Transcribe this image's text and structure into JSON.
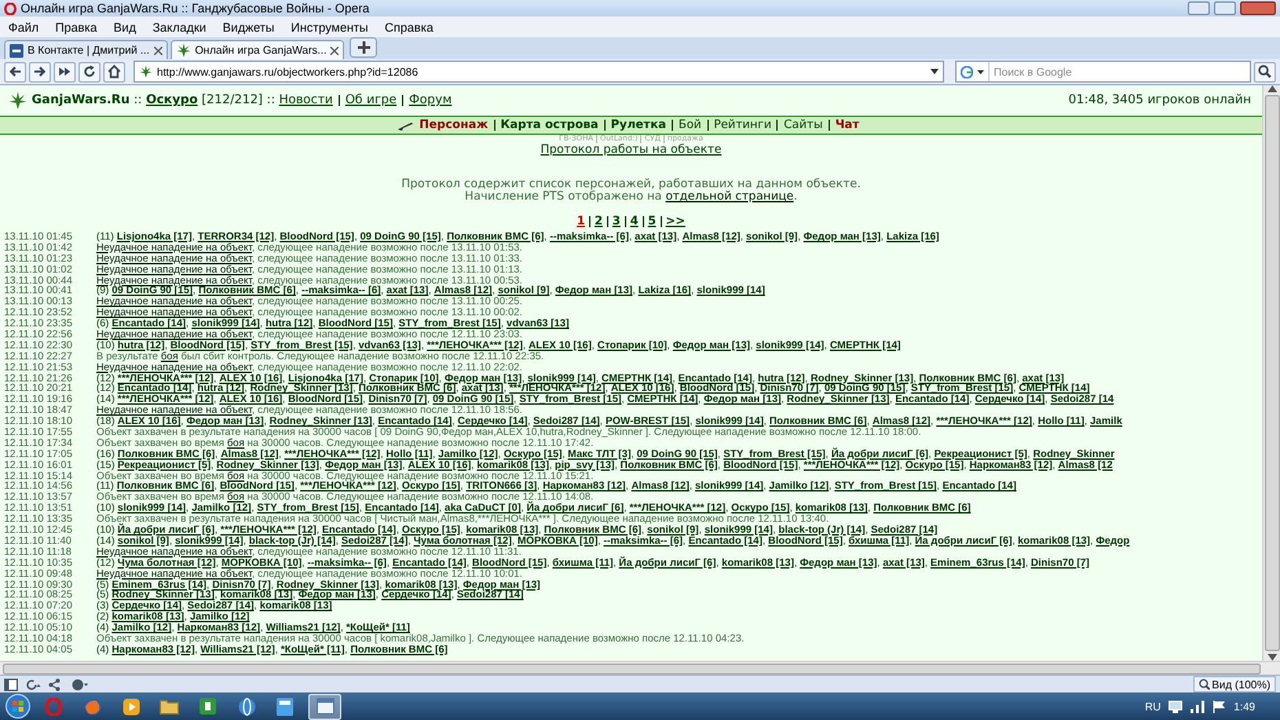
{
  "window": {
    "title": "Онлайн игра GanjaWars.Ru :: Ганджубасовые Войны - Opera"
  },
  "menu": [
    "Файл",
    "Правка",
    "Вид",
    "Закладки",
    "Виджеты",
    "Инструменты",
    "Справка"
  ],
  "tabs": [
    {
      "label": "В Контакте | Дмитрий ...",
      "selected": false,
      "kind": "vk"
    },
    {
      "label": "Онлайн игра GanjaWars...",
      "selected": true,
      "kind": "leaf"
    }
  ],
  "address": "http://www.ganjawars.ru/objectworkers.php?id=12086",
  "search": {
    "placeholder": "Поиск в Google"
  },
  "header": {
    "segments": [
      {
        "text": "GanjaWars.Ru",
        "kind": "brand"
      },
      {
        "text": " :: ",
        "kind": "text"
      },
      {
        "text": "Оскуро",
        "kind": "link"
      },
      {
        "text": " [212/212] :: ",
        "kind": "text"
      },
      {
        "text": "Новости",
        "kind": "menu"
      },
      {
        "text": "Об игре",
        "kind": "menu"
      },
      {
        "text": "Форум",
        "kind": "menu"
      }
    ],
    "online": "01:48, 3405 игроков онлайн"
  },
  "nav": [
    {
      "label": "Персонаж",
      "kind": "hot"
    },
    {
      "label": "Карта острова",
      "kind": "bold"
    },
    {
      "label": "Рулетка",
      "kind": "bold"
    },
    {
      "label": "Бой",
      "kind": "normal"
    },
    {
      "label": "Рейтинги",
      "kind": "normal"
    },
    {
      "label": "Сайты",
      "kind": "normal"
    },
    {
      "label": "Чат",
      "kind": "hot"
    }
  ],
  "sublinks": [
    "ГВ-ЗОНА",
    "OutLand:)",
    "СУД",
    "продажа"
  ],
  "protocol_link": "Протокол работы на объекте",
  "intro": [
    [
      {
        "text": "Протокол содержит список персонажей, работавших на данном объекте.",
        "link": false
      }
    ],
    [
      {
        "text": "Начисление PTS отображено на ",
        "link": false
      },
      {
        "text": "отдельной странице",
        "link": true
      },
      {
        "text": ".",
        "link": false
      }
    ]
  ],
  "pages": [
    {
      "label": "1",
      "selected": true
    },
    {
      "label": "2",
      "selected": false
    },
    {
      "label": "3",
      "selected": false
    },
    {
      "label": "4",
      "selected": false
    },
    {
      "label": "5",
      "selected": false
    },
    {
      "label": ">>",
      "selected": false
    }
  ],
  "separator": ", ",
  "log": [
    {
      "time": "13.11.10 01:45",
      "kind": "party",
      "count": "(11) ",
      "players": [
        "Lisjono4ka [17]",
        "TERROR34 [12]",
        "BloodNord [15]",
        "09 DoinG 90 [15]",
        "Полковник ВМС [6]",
        "--maksimka-- [6]",
        "axat [13]",
        "Almas8 [12]",
        "sonikol [9]",
        "Федор ман [13]",
        "Lakiza [16]"
      ]
    },
    {
      "time": "13.11.10 01:42",
      "kind": "event",
      "segments": [
        {
          "text": "Неудачное нападение на объект",
          "link": true
        },
        {
          "text": ", следующее нападение возможно после 13.11.10 01:53.",
          "link": false
        }
      ]
    },
    {
      "time": "13.11.10 01:23",
      "kind": "event",
      "segments": [
        {
          "text": "Неудачное нападение на объект",
          "link": true
        },
        {
          "text": ", следующее нападение возможно после 13.11.10 01:33.",
          "link": false
        }
      ]
    },
    {
      "time": "13.11.10 01:02",
      "kind": "event",
      "segments": [
        {
          "text": "Неудачное нападение на объект",
          "link": true
        },
        {
          "text": ", следующее нападение возможно после 13.11.10 01:13.",
          "link": false
        }
      ]
    },
    {
      "time": "13.11.10 00:44",
      "kind": "event",
      "segments": [
        {
          "text": "Неудачное нападение на объект",
          "link": true
        },
        {
          "text": ", следующее нападение возможно после 13.11.10 00:53.",
          "link": false
        }
      ]
    },
    {
      "time": "13.11.10 00:41",
      "kind": "party",
      "count": "(9) ",
      "players": [
        "09 DoinG 90 [15]",
        "Полковник ВМС [6]",
        "--maksimka-- [6]",
        "axat [13]",
        "Almas8 [12]",
        "sonikol [9]",
        "Федор ман [13]",
        "Lakiza [16]",
        "slonik999 [14]"
      ]
    },
    {
      "time": "13.11.10 00:13",
      "kind": "event",
      "segments": [
        {
          "text": "Неудачное нападение на объект",
          "link": true
        },
        {
          "text": ", следующее нападение возможно после 13.11.10 00:25.",
          "link": false
        }
      ]
    },
    {
      "time": "12.11.10 23:52",
      "kind": "event",
      "segments": [
        {
          "text": "Неудачное нападение на объект",
          "link": true
        },
        {
          "text": ", следующее нападение возможно после 13.11.10 00:02.",
          "link": false
        }
      ]
    },
    {
      "time": "12.11.10 23:35",
      "kind": "party",
      "count": "(6) ",
      "players": [
        "Encantado [14]",
        "slonik999 [14]",
        "hutra [12]",
        "BloodNord [15]",
        "STY_from_Brest [15]",
        "vdvan63 [13]"
      ]
    },
    {
      "time": "12.11.10 22:56",
      "kind": "event",
      "segments": [
        {
          "text": "Неудачное нападение на объект",
          "link": true
        },
        {
          "text": ", следующее нападение возможно после 12.11.10 23:03.",
          "link": false
        }
      ]
    },
    {
      "time": "12.11.10 22:30",
      "kind": "party",
      "count": "(10) ",
      "players": [
        "hutra [12]",
        "BloodNord [15]",
        "STY_from_Brest [15]",
        "vdvan63 [13]",
        "***ЛЕНОЧКА*** [12]",
        "ALEX 10 [16]",
        "Стопарик [10]",
        "Федор ман [13]",
        "slonik999 [14]",
        "СМЕРТНК [14]"
      ]
    },
    {
      "time": "12.11.10 22:27",
      "kind": "event",
      "segments": [
        {
          "text": "В результате ",
          "link": false
        },
        {
          "text": "боя",
          "link": true
        },
        {
          "text": " был сбит контроль. Следующее нападение возможно после 12.11.10 22:35.",
          "link": false
        }
      ]
    },
    {
      "time": "12.11.10 21:53",
      "kind": "event",
      "segments": [
        {
          "text": "Неудачное нападение на объект",
          "link": true
        },
        {
          "text": ", следующее нападение возможно после 12.11.10 22:02.",
          "link": false
        }
      ]
    },
    {
      "time": "12.11.10 21:26",
      "kind": "party",
      "count": "(12) ",
      "players": [
        "***ЛЕНОЧКА*** [12]",
        "ALEX 10 [16]",
        "Lisjono4ka [17]",
        "Стопарик [10]",
        "Федор ман [13]",
        "slonik999 [14]",
        "СМЕРТНК [14]",
        "Encantado [14]",
        "hutra [12]",
        "Rodney_Skinner [13]",
        "Полковник ВМС [6]",
        "axat [13]"
      ]
    },
    {
      "time": "12.11.10 20:21",
      "kind": "party",
      "count": "(12) ",
      "players": [
        "Encantado [14]",
        "hutra [12]",
        "Rodney_Skinner [13]",
        "Полковник ВМС [6]",
        "axat [13]",
        "***ЛЕНОЧКА*** [12]",
        "ALEX 10 [16]",
        "BloodNord [15]",
        "Dinisn70 [7]",
        "09 DoinG 90 [15]",
        "STY_from_Brest [15]",
        "СМЕРТНК [14]"
      ]
    },
    {
      "time": "12.11.10 19:16",
      "kind": "party",
      "count": "(14) ",
      "players": [
        "***ЛЕНОЧКА*** [12]",
        "ALEX 10 [16]",
        "BloodNord [15]",
        "Dinisn70 [7]",
        "09 DoinG 90 [15]",
        "STY_from_Brest [15]",
        "СМЕРТНК [14]",
        "Федор ман [13]",
        "Rodney_Skinner [13]",
        "Encantado [14]",
        "Сердечко [14]",
        "Sedoi287 [14"
      ]
    },
    {
      "time": "12.11.10 18:47",
      "kind": "event",
      "segments": [
        {
          "text": "Неудачное нападение на объект",
          "link": true
        },
        {
          "text": ", следующее нападение возможно после 12.11.10 18:56.",
          "link": false
        }
      ]
    },
    {
      "time": "12.11.10 18:10",
      "kind": "party",
      "count": "(18) ",
      "players": [
        "ALEX 10 [16]",
        "Федор ман [13]",
        "Rodney_Skinner [13]",
        "Encantado [14]",
        "Сердечко [14]",
        "Sedoi287 [14]",
        "POW-BREST [15]",
        "slonik999 [14]",
        "Полковник ВМС [6]",
        "Almas8 [12]",
        "***ЛЕНОЧКА*** [12]",
        "Hollo [11]",
        "Jamilk"
      ]
    },
    {
      "time": "12.11.10 17:55",
      "kind": "event",
      "segments": [
        {
          "text": "Объект захвачен в результате нападения на 30000 часов [ 09 DoinG 90,Федор ман,ALEX 10,hutra,Rodney_Skinner ]. Следующее нападение возможно после 12.11.10 18:00.",
          "link": false
        }
      ]
    },
    {
      "time": "12.11.10 17:34",
      "kind": "event",
      "segments": [
        {
          "text": "Объект захвачен во время ",
          "link": false
        },
        {
          "text": "боя",
          "link": true
        },
        {
          "text": " на 30000 часов. Следующее нападение возможно после 12.11.10 17:42.",
          "link": false
        }
      ]
    },
    {
      "time": "12.11.10 17:05",
      "kind": "party",
      "count": "(16) ",
      "players": [
        "Полковник ВМС [6]",
        "Almas8 [12]",
        "***ЛЕНОЧКА*** [12]",
        "Hollo [11]",
        "Jamilko [12]",
        "Оскуро [15]",
        "Макс ТЛТ [3]",
        "09 DoinG 90 [15]",
        "STY_from_Brest [15]",
        "Йа добри лисиГ [6]",
        "Рекреационист [5]",
        "Rodney_Skinner"
      ]
    },
    {
      "time": "12.11.10 16:01",
      "kind": "party",
      "count": "(15) ",
      "players": [
        "Рекреационист [5]",
        "Rodney_Skinner [13]",
        "Федор ман [13]",
        "ALEX 10 [16]",
        "komarik08 [13]",
        "pip_svy [13]",
        "Полковник ВМС [6]",
        "BloodNord [15]",
        "***ЛЕНОЧКА*** [12]",
        "Оскуро [15]",
        "Наркоман83 [12]",
        "Almas8 [12"
      ]
    },
    {
      "time": "12.11.10 15:14",
      "kind": "event",
      "segments": [
        {
          "text": "Объект захвачен во время ",
          "link": false
        },
        {
          "text": "боя",
          "link": true
        },
        {
          "text": " на 30000 часов. Следующее нападение возможно после 12.11.10 15:21.",
          "link": false
        }
      ]
    },
    {
      "time": "12.11.10 14:56",
      "kind": "party",
      "count": "(11) ",
      "players": [
        "Полковник ВМС [6]",
        "BloodNord [15]",
        "***ЛЕНОЧКА*** [12]",
        "Оскуро [15]",
        "TRITON666 [3]",
        "Наркоман83 [12]",
        "Almas8 [12]",
        "slonik999 [14]",
        "Jamilko [12]",
        "STY_from_Brest [15]",
        "Encantado [14]"
      ]
    },
    {
      "time": "12.11.10 13:57",
      "kind": "event",
      "segments": [
        {
          "text": "Объект захвачен во время ",
          "link": false
        },
        {
          "text": "боя",
          "link": true
        },
        {
          "text": " на 30000 часов. Следующее нападение возможно после 12.11.10 14:08.",
          "link": false
        }
      ]
    },
    {
      "time": "12.11.10 13:51",
      "kind": "party",
      "count": "(10) ",
      "players": [
        "slonik999 [14]",
        "Jamilko [12]",
        "STY_from_Brest [15]",
        "Encantado [14]",
        "aka CaDuCT [0]",
        "Йа добри лисиГ [6]",
        "***ЛЕНОЧКА*** [12]",
        "Оскуро [15]",
        "komarik08 [13]",
        "Полковник ВМС [6]"
      ]
    },
    {
      "time": "12.11.10 13:35",
      "kind": "event",
      "segments": [
        {
          "text": "Объект захвачен в результате нападения на 30000 часов [ Чистый ман,Almas8,***ЛЕНОЧКА*** ]. Следующее нападение возможно после 12.11.10 13:40.",
          "link": false
        }
      ]
    },
    {
      "time": "12.11.10 12:45",
      "kind": "party",
      "count": "(10) ",
      "players": [
        "Йа добри лисиГ [6]",
        "***ЛЕНОЧКА*** [12]",
        "Encantado [14]",
        "Оскуро [15]",
        "komarik08 [13]",
        "Полковник ВМС [6]",
        "sonikol [9]",
        "slonik999 [14]",
        "black-top (Jr) [14]",
        "Sedoi287 [14]"
      ]
    },
    {
      "time": "12.11.10 11:40",
      "kind": "party",
      "count": "(14) ",
      "players": [
        "sonikol [9]",
        "slonik999 [14]",
        "black-top (Jr) [14]",
        "Sedoi287 [14]",
        "Чума болотная [12]",
        "МОРКОВКА [10]",
        "--maksimka-- [6]",
        "Encantado [14]",
        "BloodNord [15]",
        "бхишма [11]",
        "Йа добри лисиГ [6]",
        "komarik08 [13]",
        "Федор"
      ]
    },
    {
      "time": "12.11.10 11:18",
      "kind": "event",
      "segments": [
        {
          "text": "Неудачное нападение на объект",
          "link": true
        },
        {
          "text": ", следующее нападение возможно после 12.11.10 11:31.",
          "link": false
        }
      ]
    },
    {
      "time": "12.11.10 10:35",
      "kind": "party",
      "count": "(12) ",
      "players": [
        "Чума болотная [12]",
        "МОРКОВКА [10]",
        "--maksimka-- [6]",
        "Encantado [14]",
        "BloodNord [15]",
        "бхишма [11]",
        "Йа добри лисиГ [6]",
        "komarik08 [13]",
        "Федор ман [13]",
        "axat [13]",
        "Eminem_63rus [14]",
        "Dinisn70 [7]"
      ]
    },
    {
      "time": "12.11.10 09:48",
      "kind": "event",
      "segments": [
        {
          "text": "Неудачное нападение на объект",
          "link": true
        },
        {
          "text": ", следующее нападение возможно после 12.11.10 10:01.",
          "link": false
        }
      ]
    },
    {
      "time": "12.11.10 09:30",
      "kind": "party",
      "count": "(5) ",
      "players": [
        "Eminem_63rus [14]",
        "Dinisn70 [7]",
        "Rodney_Skinner [13]",
        "komarik08 [13]",
        "Федор ман [13]"
      ]
    },
    {
      "time": "12.11.10 08:25",
      "kind": "party",
      "count": "(5) ",
      "players": [
        "Rodney_Skinner [13]",
        "komarik08 [13]",
        "Федор ман [13]",
        "Сердечко [14]",
        "Sedoi287 [14]"
      ]
    },
    {
      "time": "12.11.10 07:20",
      "kind": "party",
      "count": "(3) ",
      "players": [
        "Сердечко [14]",
        "Sedoi287 [14]",
        "komarik08 [13]"
      ]
    },
    {
      "time": "12.11.10 06:15",
      "kind": "party",
      "count": "(2) ",
      "players": [
        "komarik08 [13]",
        "Jamilko [12]"
      ]
    },
    {
      "time": "12.11.10 05:10",
      "kind": "party",
      "count": "(4) ",
      "players": [
        "Jamilko [12]",
        "Наркоман83 [12]",
        "Williams21 [12]",
        "*КоЩей* [11]"
      ]
    },
    {
      "time": "12.11.10 04:18",
      "kind": "event",
      "segments": [
        {
          "text": "Объект захвачен в результате нападения на 30000 часов [ komarik08,Jamilko ]. Следующее нападение возможно после 12.11.10 04:23.",
          "link": false
        }
      ]
    },
    {
      "time": "12.11.10 04:05",
      "kind": "party",
      "count": "(4) ",
      "players": [
        "Наркоман83 [12]",
        "Williams21 [12]",
        "*КоЩей* [11]",
        "Полковник ВМС [6]"
      ]
    }
  ],
  "status_bar": {
    "zoom": "Вид (100%)"
  },
  "taskbar": {
    "apps": [
      {
        "kind": "opera",
        "selected": false
      },
      {
        "kind": "firefox",
        "selected": false
      },
      {
        "kind": "media",
        "selected": false
      },
      {
        "kind": "folder",
        "selected": false
      },
      {
        "kind": "green",
        "selected": false
      },
      {
        "kind": "ball",
        "selected": false
      },
      {
        "kind": "blue",
        "selected": false
      },
      {
        "kind": "window",
        "selected": true
      }
    ],
    "language": "RU",
    "clock": "1:49"
  }
}
